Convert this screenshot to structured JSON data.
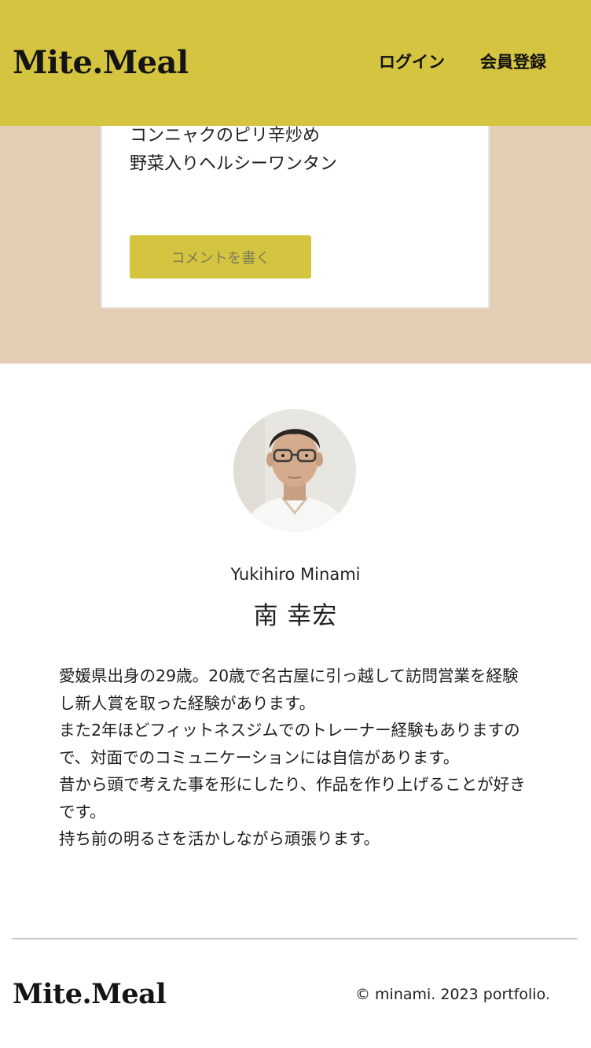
{
  "header": {
    "logo": "Mite.Meal",
    "nav": {
      "login": "ログイン",
      "signup": "会員登録"
    }
  },
  "recipe_card": {
    "items": [
      "コンニャクのピリ辛炒め",
      "野菜入りヘルシーワンタン"
    ],
    "comment_button": "コメントを書く"
  },
  "profile": {
    "avatar_icon": "person-photo",
    "name_en": "Yukihiro Minami",
    "name_ja": "南 幸宏",
    "bio": [
      "愛媛県出身の29歳。20歳で名古屋に引っ越して訪問営業を経験し新人賞を取った経験があります。",
      "また2年ほどフィットネスジムでのトレーナー経験もありますので、対面でのコミュニケーションには自信があります。",
      "昔から頭で考えた事を形にしたり、作品を作り上げることが好きです。",
      "持ち前の明るさを活かしながら頑張ります。"
    ]
  },
  "footer": {
    "logo": "Mite.Meal",
    "copyright": "© minami. 2023 portfolio."
  },
  "colors": {
    "accent": "#d4c440",
    "band": "#e4cdb5",
    "text": "#222222"
  }
}
